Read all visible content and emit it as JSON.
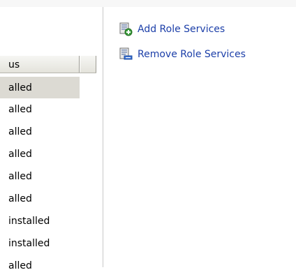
{
  "table": {
    "header": {
      "status_label": "us"
    },
    "rows": [
      {
        "status": "alled"
      },
      {
        "status": "alled"
      },
      {
        "status": "alled"
      },
      {
        "status": "alled"
      },
      {
        "status": "alled"
      },
      {
        "status": "alled"
      },
      {
        "status": "installed"
      },
      {
        "status": "installed"
      },
      {
        "status": "alled"
      }
    ]
  },
  "actions": {
    "add_role_services": "Add Role Services",
    "remove_role_services": "Remove Role Services"
  },
  "colors": {
    "link": "#1b3ea8",
    "selected_row": "#dcdad3",
    "header_bg": "#ecebe5"
  },
  "icons": {
    "add": "add-role-services-icon",
    "remove": "remove-role-services-icon"
  }
}
